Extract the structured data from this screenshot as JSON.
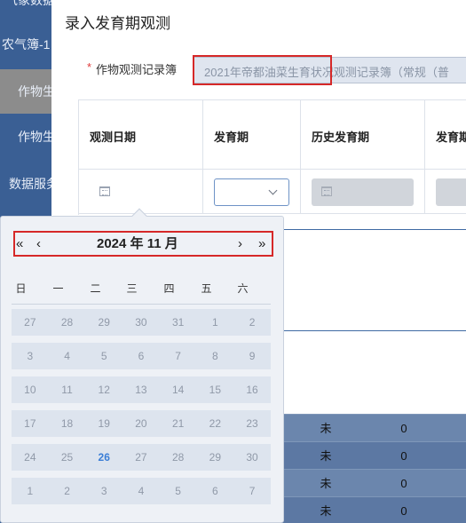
{
  "sidebar": {
    "items": [
      {
        "label": "气象数据"
      },
      {
        "label": "农气簿-1"
      },
      {
        "label": "作物生"
      },
      {
        "label": "作物生"
      },
      {
        "label": "数据服务"
      }
    ]
  },
  "background_table": {
    "rows": [
      {
        "c1": "未",
        "c2": "0",
        "c3": ""
      },
      {
        "c1": "未",
        "c2": "0",
        "c3": ""
      },
      {
        "c1": "未",
        "c2": "0",
        "c3": ""
      },
      {
        "c1": "未",
        "c2": "0",
        "c3": ""
      }
    ]
  },
  "modal": {
    "title": "录入发育期观测",
    "required_mark": "*",
    "field_label": "作物观测记录簿",
    "record_book_value": "2021年帝都油菜生育状况观测记录簿（常规（普",
    "table": {
      "headers": [
        "观测日期",
        "发育期",
        "历史发育期",
        "发育期"
      ]
    }
  },
  "datepicker": {
    "prev_year": "«",
    "prev_month": "‹",
    "next_month": "›",
    "next_year": "»",
    "year_month": "2024 年  11 月",
    "weekdays": [
      "日",
      "一",
      "二",
      "三",
      "四",
      "五",
      "六"
    ],
    "weeks": [
      [
        "27",
        "28",
        "29",
        "30",
        "31",
        "1",
        "2"
      ],
      [
        "3",
        "4",
        "5",
        "6",
        "7",
        "8",
        "9"
      ],
      [
        "10",
        "11",
        "12",
        "13",
        "14",
        "15",
        "16"
      ],
      [
        "17",
        "18",
        "19",
        "20",
        "21",
        "22",
        "23"
      ],
      [
        "24",
        "25",
        "26",
        "27",
        "28",
        "29",
        "30"
      ],
      [
        "1",
        "2",
        "3",
        "4",
        "5",
        "6",
        "7"
      ]
    ],
    "today": "26",
    "today_color": "#3b7ed6"
  },
  "colors": {
    "highlight": "#d62828",
    "sidebar_bg": "#3a5f94"
  }
}
